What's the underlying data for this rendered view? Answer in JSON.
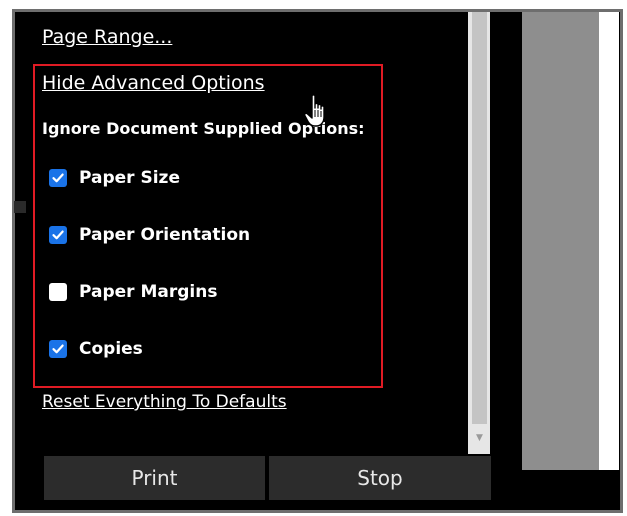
{
  "panel": {
    "page_range_link": "Page Range...",
    "hide_advanced_link": "Hide Advanced Options",
    "ignore_label": "Ignore Document Supplied Options:",
    "options": [
      {
        "label": "Paper Size",
        "checked": true
      },
      {
        "label": "Paper Orientation",
        "checked": true
      },
      {
        "label": "Paper Margins",
        "checked": false
      },
      {
        "label": "Copies",
        "checked": true
      }
    ],
    "reset_link": "Reset Everything To Defaults"
  },
  "buttons": {
    "print": "Print",
    "stop": "Stop"
  },
  "colors": {
    "background": "#000000",
    "checkbox_checked": "#1a73e8",
    "highlight_border": "#e01b24",
    "button_bg": "#2c2c2c"
  },
  "icons": {
    "checkbox_checked": "checkmark-icon",
    "scroll_down": "scroll-down-arrow-icon",
    "cursor": "hand-pointer-cursor-icon"
  }
}
